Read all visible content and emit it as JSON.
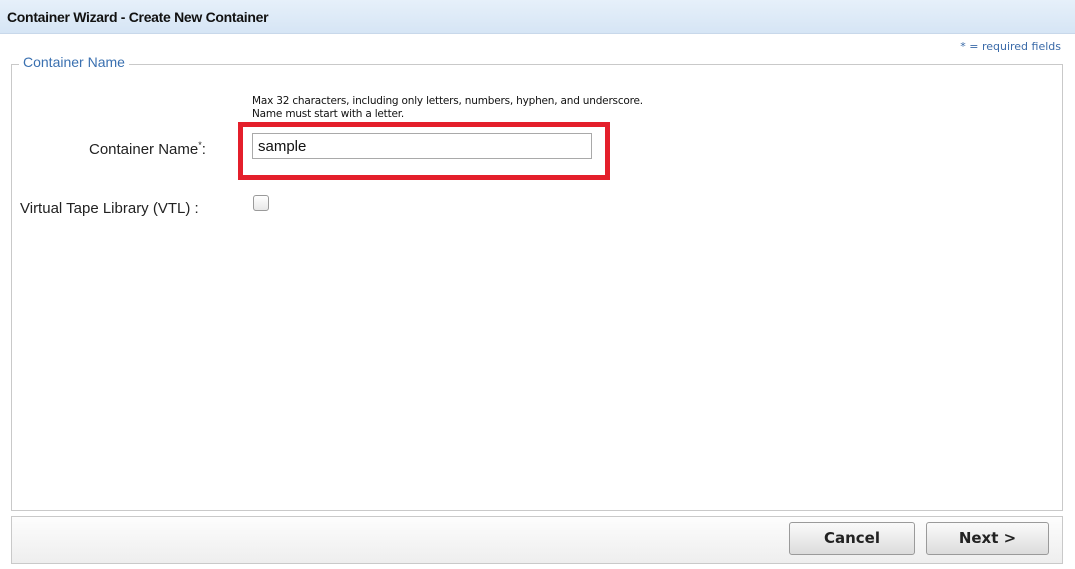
{
  "window": {
    "title": "Container Wizard - Create New Container"
  },
  "required_note": "* = required fields",
  "section": {
    "legend": "Container Name",
    "hint": "Max 32 characters, including only letters, numbers, hyphen, and underscore. Name must start with a letter.",
    "container_name": {
      "label": "Container Name",
      "required_mark": "*",
      "suffix": ":",
      "value": "sample"
    },
    "vtl": {
      "label": "Virtual Tape Library (VTL) :",
      "checked": false
    }
  },
  "footer": {
    "cancel_label": "Cancel",
    "next_label": "Next >"
  },
  "colors": {
    "highlight": "#e41f2b",
    "legend": "#3a70b0"
  }
}
